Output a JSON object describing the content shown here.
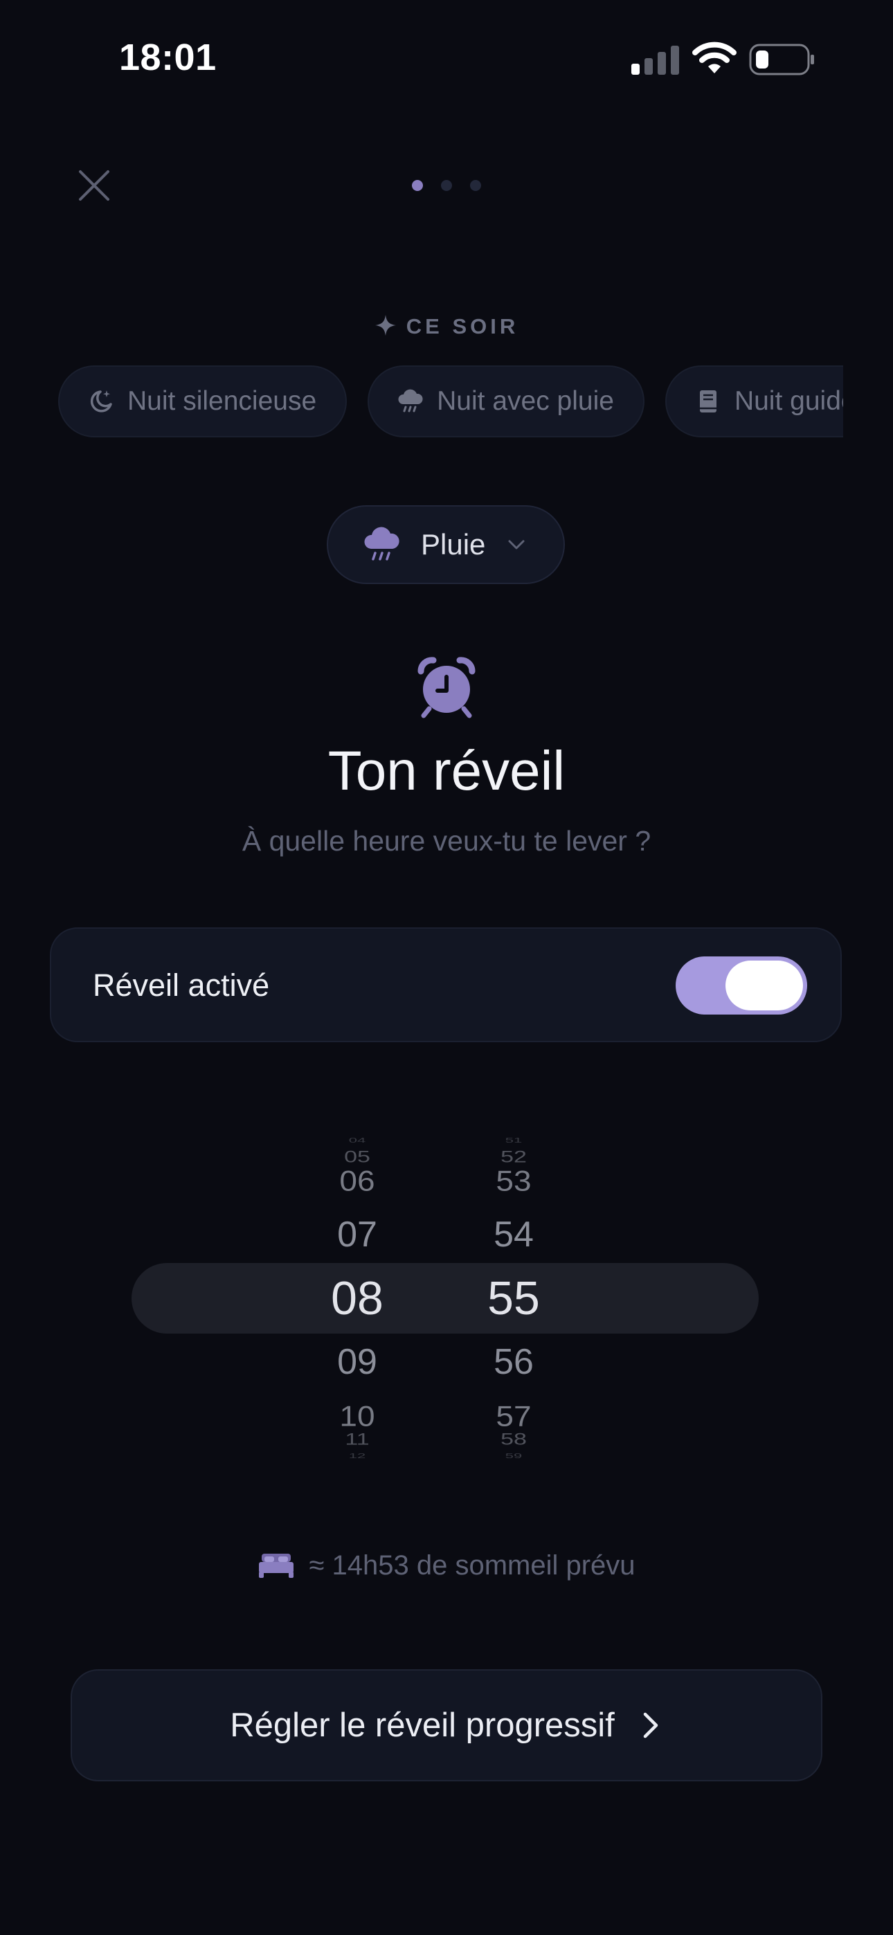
{
  "status_bar": {
    "time": "18:01"
  },
  "pager": {
    "count": 3,
    "active_index": 0
  },
  "tonight": {
    "label": "CE SOIR",
    "chips": [
      {
        "label": "Nuit silencieuse",
        "icon": "moon-sparkle-icon"
      },
      {
        "label": "Nuit avec pluie",
        "icon": "rain-cloud-icon"
      },
      {
        "label": "Nuit guidée",
        "icon": "book-icon"
      }
    ]
  },
  "sound_selector": {
    "label": "Pluie",
    "icon": "rain-cloud-icon"
  },
  "alarm": {
    "title": "Ton réveil",
    "subtitle": "À quelle heure veux-tu te lever ?",
    "toggle_label": "Réveil activé",
    "enabled": true
  },
  "picker": {
    "hours": [
      "04",
      "05",
      "06",
      "07",
      "08",
      "09",
      "10",
      "11",
      "12"
    ],
    "minutes": [
      "51",
      "52",
      "53",
      "54",
      "55",
      "56",
      "57",
      "58",
      "59"
    ],
    "selected_hour": "08",
    "selected_minute": "55"
  },
  "sleep_info": {
    "text": "≈ 14h53 de sommeil prévu",
    "icon": "bed-icon"
  },
  "cta": {
    "label": "Régler le réveil progressif"
  },
  "colors": {
    "background": "#0a0b12",
    "accent": "#a69adf",
    "card": "#121623"
  }
}
